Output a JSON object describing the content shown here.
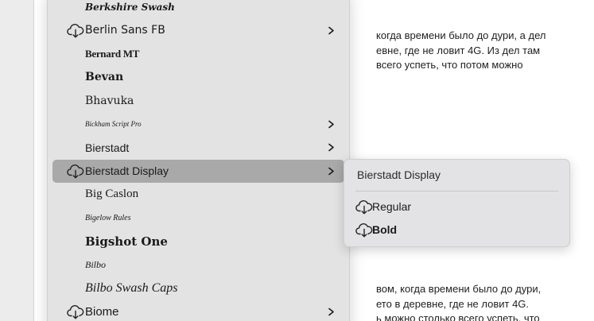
{
  "document": {
    "paragraph_top": [
      "когда времени было до дури, а дел",
      "евне, где не ловит 4G. Из дел там",
      "всего успеть, что потом можно"
    ],
    "paragraph_bottom": [
      "вом, когда времени было до дури,",
      "ето в деревне, где не ловит 4G.",
      "ь можно столько всего успеть, что"
    ]
  },
  "font_menu": {
    "items": [
      {
        "label": "Berkshire Swash",
        "font_class": "f-berkshire",
        "download_icon": false,
        "has_submenu": false,
        "highlighted": false
      },
      {
        "label": "Berlin Sans FB",
        "font_class": "f-berlin",
        "download_icon": true,
        "has_submenu": true,
        "highlighted": false
      },
      {
        "label": "Bernard MT",
        "font_class": "f-bernard",
        "download_icon": false,
        "has_submenu": false,
        "highlighted": false
      },
      {
        "label": "Bevan",
        "font_class": "f-bevan",
        "download_icon": false,
        "has_submenu": false,
        "highlighted": false
      },
      {
        "label": "Bhavuka",
        "font_class": "f-bhavuka",
        "download_icon": false,
        "has_submenu": false,
        "highlighted": false
      },
      {
        "label": "Bickham Script Pro",
        "font_class": "f-bickham",
        "download_icon": false,
        "has_submenu": true,
        "highlighted": false
      },
      {
        "label": "Bierstadt",
        "font_class": "f-bierstadt",
        "download_icon": false,
        "has_submenu": true,
        "highlighted": false
      },
      {
        "label": "Bierstadt Display",
        "font_class": "f-bierstadt",
        "download_icon": true,
        "has_submenu": true,
        "highlighted": true
      },
      {
        "label": "Big Caslon",
        "font_class": "f-bigcaslon",
        "download_icon": false,
        "has_submenu": false,
        "highlighted": false
      },
      {
        "label": "Bigelow Rules",
        "font_class": "f-bigelow",
        "download_icon": false,
        "has_submenu": false,
        "highlighted": false
      },
      {
        "label": "Bigshot One",
        "font_class": "f-bigshot",
        "download_icon": false,
        "has_submenu": false,
        "highlighted": false
      },
      {
        "label": "Bilbo",
        "font_class": "f-bilbo",
        "download_icon": false,
        "has_submenu": false,
        "highlighted": false
      },
      {
        "label": "Bilbo Swash Caps",
        "font_class": "f-bilboswash",
        "download_icon": false,
        "has_submenu": false,
        "highlighted": false
      },
      {
        "label": "Biome",
        "font_class": "f-biome",
        "download_icon": true,
        "has_submenu": true,
        "highlighted": false
      }
    ]
  },
  "submenu": {
    "title": "Bierstadt Display",
    "items": [
      {
        "label": "Regular",
        "bold": false,
        "download_icon": true
      },
      {
        "label": "Bold",
        "bold": true,
        "download_icon": true
      }
    ]
  },
  "icons": {
    "download": "cloud-download-icon",
    "submenu_arrow": "chevron-right-icon"
  },
  "colors": {
    "menu_bg": "#e3e3e3",
    "highlight": "#a9a9a9",
    "text": "#1a1a1a"
  }
}
